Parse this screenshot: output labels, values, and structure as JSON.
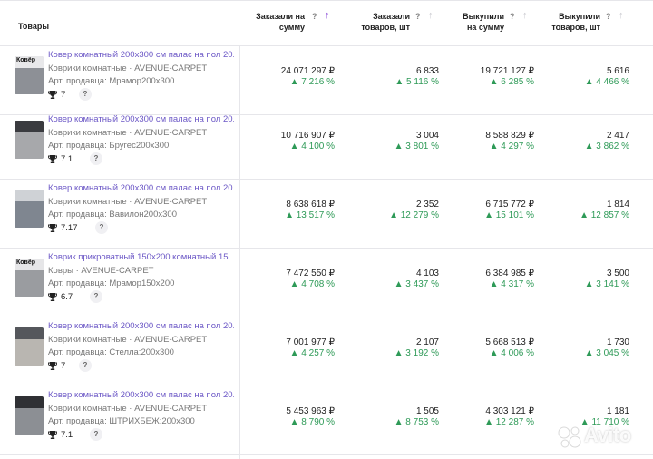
{
  "header": {
    "goods_label": "Товары",
    "columns": [
      {
        "line1": "Заказали на",
        "line2": "сумму",
        "q": "?",
        "sort": "active"
      },
      {
        "line1": "Заказали",
        "line2": "товаров, шт",
        "q": "?",
        "sort": "idle"
      },
      {
        "line1": "Выкупили",
        "line2": "на сумму",
        "q": "?",
        "sort": "idle"
      },
      {
        "line1": "Выкупили",
        "line2": "товаров, шт",
        "q": "?",
        "sort": "idle"
      }
    ]
  },
  "rows": [
    {
      "thumb_label": "Ковёр",
      "thumb_colors": [
        "#e8e8ea",
        "#8d9096"
      ],
      "title": "Ковер комнатный 200х300 см палас на пол 20...",
      "brand": "Коврики комнатные · AVENUE-CARPET",
      "sku": "Арт. продавца: Мрамор200х300",
      "rating": "7",
      "q": "?",
      "ordered_sum": "24 071 297 ₽",
      "ordered_sum_delta": "▲ 7 216 %",
      "ordered_qty": "6 833",
      "ordered_qty_delta": "▲ 5 116 %",
      "bought_sum": "19 721 127 ₽",
      "bought_sum_delta": "▲ 6 285 %",
      "bought_qty": "5 616",
      "bought_qty_delta": "▲ 4 466 %"
    },
    {
      "thumb_label": "",
      "thumb_colors": [
        "#3a3b3f",
        "#a7a8ab"
      ],
      "title": "Ковер комнатный 200х300 см палас на пол 20...",
      "brand": "Коврики комнатные · AVENUE-CARPET",
      "sku": "Арт. продавца: Бругес200х300",
      "rating": "7.1",
      "q": "?",
      "ordered_sum": "10 716 907 ₽",
      "ordered_sum_delta": "▲ 4 100 %",
      "ordered_qty": "3 004",
      "ordered_qty_delta": "▲ 3 801 %",
      "bought_sum": "8 588 829 ₽",
      "bought_sum_delta": "▲ 4 297 %",
      "bought_qty": "2 417",
      "bought_qty_delta": "▲ 3 862 %"
    },
    {
      "thumb_label": "",
      "thumb_colors": [
        "#cfd2d6",
        "#7f8690"
      ],
      "title": "Ковер комнатный 200х300 см палас на пол 20...",
      "brand": "Коврики комнатные · AVENUE-CARPET",
      "sku": "Арт. продавца: Вавилон200х300",
      "rating": "7.17",
      "q": "?",
      "ordered_sum": "8 638 618 ₽",
      "ordered_sum_delta": "▲ 13 517 %",
      "ordered_qty": "2 352",
      "ordered_qty_delta": "▲ 12 279 %",
      "bought_sum": "6 715 772 ₽",
      "bought_sum_delta": "▲ 15 101 %",
      "bought_qty": "1 814",
      "bought_qty_delta": "▲ 12 857 %"
    },
    {
      "thumb_label": "Ковёр",
      "thumb_colors": [
        "#e6e6e8",
        "#9a9ca0"
      ],
      "title": "Коврик прикроватный 150х200 комнатный 15...",
      "brand": "Ковры · AVENUE-CARPET",
      "sku": "Арт. продавца: Мрамор150х200",
      "rating": "6.7",
      "q": "?",
      "ordered_sum": "7 472 550 ₽",
      "ordered_sum_delta": "▲ 4 708 %",
      "ordered_qty": "4 103",
      "ordered_qty_delta": "▲ 3 437 %",
      "bought_sum": "6 384 985 ₽",
      "bought_sum_delta": "▲ 4 317 %",
      "bought_qty": "3 500",
      "bought_qty_delta": "▲ 3 141 %"
    },
    {
      "thumb_label": "",
      "thumb_colors": [
        "#55575c",
        "#b9b6b1"
      ],
      "title": "Ковер комнатный 200х300 см палас на пол 20...",
      "brand": "Коврики комнатные · AVENUE-CARPET",
      "sku": "Арт. продавца: Стелла:200х300",
      "rating": "7",
      "q": "?",
      "ordered_sum": "7 001 977 ₽",
      "ordered_sum_delta": "▲ 4 257 %",
      "ordered_qty": "2 107",
      "ordered_qty_delta": "▲ 3 192 %",
      "bought_sum": "5 668 513 ₽",
      "bought_sum_delta": "▲ 4 006 %",
      "bought_qty": "1 730",
      "bought_qty_delta": "▲ 3 045 %"
    },
    {
      "thumb_label": "",
      "thumb_colors": [
        "#2f3034",
        "#8c8f94"
      ],
      "title": "Ковер комнатный 200х300 см палас на пол 20...",
      "brand": "Коврики комнатные · AVENUE-CARPET",
      "sku": "Арт. продавца: ШТРИХБЕЖ:200х300",
      "rating": "7.1",
      "q": "?",
      "ordered_sum": "5 453 963 ₽",
      "ordered_sum_delta": "▲ 8 790 %",
      "ordered_qty": "1 505",
      "ordered_qty_delta": "▲ 8 753 %",
      "bought_sum": "4 303 121 ₽",
      "bought_sum_delta": "▲ 12 287 %",
      "bought_qty": "1 181",
      "bought_qty_delta": "▲ 11 710 %"
    }
  ],
  "watermark": {
    "text": "Avito"
  },
  "colors": {
    "accent": "#8b4dd8",
    "link": "#6b57c6",
    "positive": "#2e9a57",
    "border": "#e6e6ea"
  }
}
